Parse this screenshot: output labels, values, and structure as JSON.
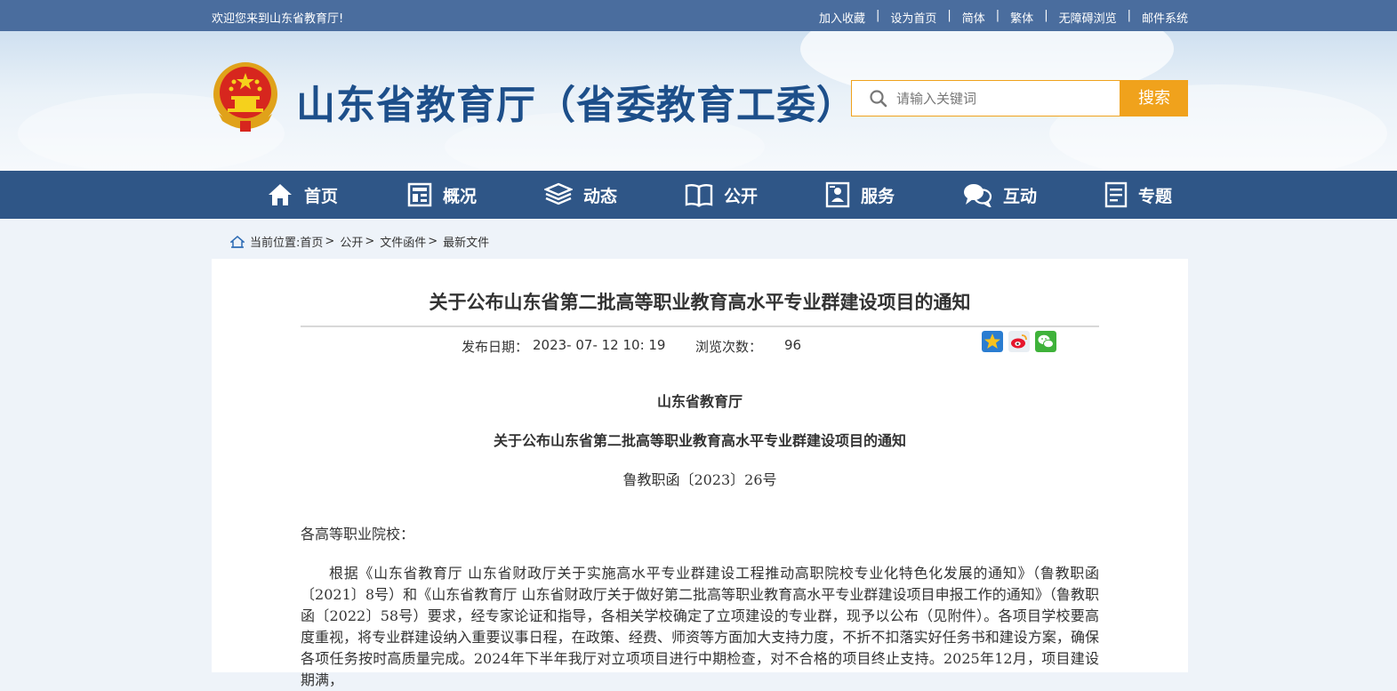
{
  "topbar": {
    "welcome": "欢迎您来到山东省教育厅!",
    "links": [
      "加入收藏",
      "设为首页",
      "简体",
      "繁体",
      "无障碍浏览",
      "邮件系统"
    ],
    "separator": "|"
  },
  "header": {
    "site_title": "山东省教育厅（省委教育工委）",
    "search_placeholder": "请输入关键词",
    "search_button": "搜索"
  },
  "nav": {
    "items": [
      {
        "label": "首页",
        "icon": "home-icon"
      },
      {
        "label": "概况",
        "icon": "overview-icon"
      },
      {
        "label": "动态",
        "icon": "layers-icon"
      },
      {
        "label": "公开",
        "icon": "book-icon"
      },
      {
        "label": "服务",
        "icon": "service-icon"
      },
      {
        "label": "互动",
        "icon": "chat-icon"
      },
      {
        "label": "专题",
        "icon": "document-icon"
      }
    ]
  },
  "breadcrumb": {
    "prefix": "当前位置:",
    "items": [
      "首页",
      "公开",
      "文件函件",
      "最新文件"
    ],
    "separator": ">"
  },
  "article": {
    "title": "关于公布山东省第二批高等职业教育高水平专业群建设项目的通知",
    "date_label": "发布日期：",
    "date_value": "2023- 07- 12 10: 19",
    "views_label": "浏览次数：",
    "views_value": "96",
    "issuer": "山东省教育厅",
    "doc_title": "关于公布山东省第二批高等职业教育高水平专业群建设项目的通知",
    "doc_number": "鲁教职函〔2023〕26号",
    "salutation": "各高等职业院校：",
    "body": "根据《山东省教育厅 山东省财政厅关于实施高水平专业群建设工程推动高职院校专业化特色化发展的通知》（鲁教职函〔2021〕8号）和《山东省教育厅 山东省财政厅关于做好第二批高等职业教育高水平专业群建设项目申报工作的通知》（鲁教职函〔2022〕58号）要求，经专家论证和指导，各相关学校确定了立项建设的专业群，现予以公布（见附件）。各项目学校要高度重视，将专业群建设纳入重要议事日程，在政策、经费、师资等方面加大支持力度，不折不扣落实好任务书和建设方案，确保各项任务按时高质量完成。2024年下半年我厅对立项项目进行中期检查，对不合格的项目终止支持。2025年12月，项目建设期满，"
  },
  "colors": {
    "topbar": "#4a6d9e",
    "nav": "#2f5687",
    "accent": "#f0a21c",
    "title_blue": "#1d4f8a"
  }
}
